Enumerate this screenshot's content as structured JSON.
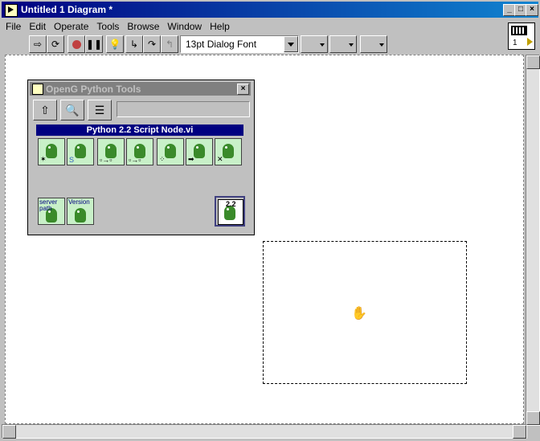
{
  "window": {
    "title": "Untitled 1 Diagram *"
  },
  "menu": [
    "File",
    "Edit",
    "Operate",
    "Tools",
    "Browse",
    "Window",
    "Help"
  ],
  "toolbar": {
    "font": "13pt Dialog Font"
  },
  "vi_icon": {
    "number": "1"
  },
  "palette": {
    "title": "OpenG Python Tools",
    "subpalette": "Python 2.2 Script Node.vi",
    "icons": [
      {
        "name": "script-node-new-icon",
        "label": ""
      },
      {
        "name": "script-node-load-icon",
        "label": ""
      },
      {
        "name": "script-node-input-icon",
        "label": ""
      },
      {
        "name": "script-node-output-icon",
        "label": ""
      },
      {
        "name": "script-node-indexed-icon",
        "label": ""
      },
      {
        "name": "script-node-run-icon",
        "label": ""
      },
      {
        "name": "script-node-close-icon",
        "label": ""
      }
    ],
    "row2": [
      {
        "name": "server-path-icon",
        "label": "server path"
      },
      {
        "name": "version-icon",
        "label": "Version"
      }
    ],
    "node_version": "2.2"
  }
}
